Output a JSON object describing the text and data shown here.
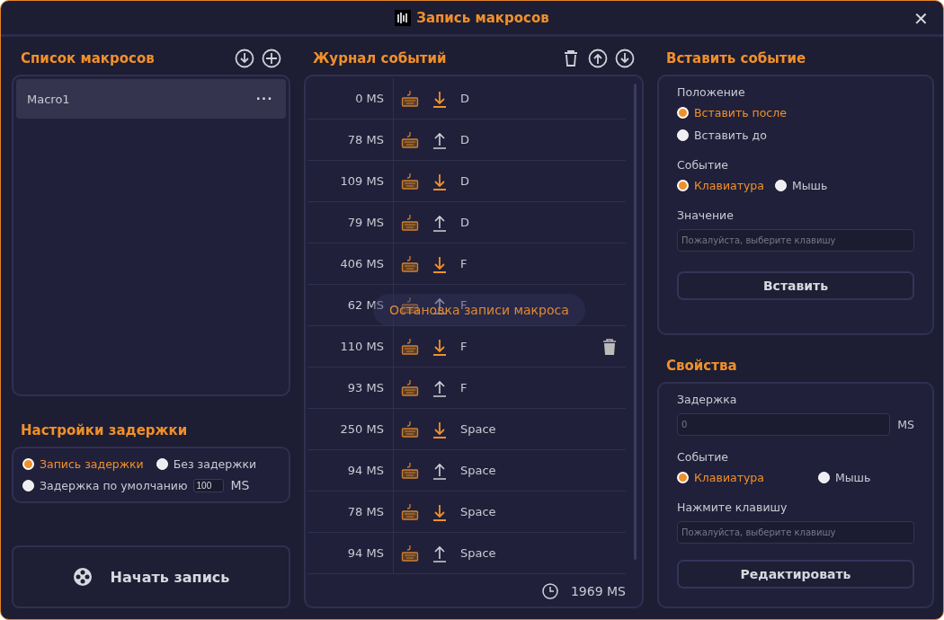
{
  "window": {
    "title": "Запись макросов",
    "close": "✕"
  },
  "macro_list": {
    "title": "Список макросов",
    "items": [
      {
        "name": "Macro1",
        "menu": "···",
        "selected": true
      }
    ]
  },
  "delay_settings": {
    "title": "Настройки задержки",
    "options": [
      {
        "label": "Запись задержки",
        "selected": true
      },
      {
        "label": "Без задержки",
        "selected": false
      },
      {
        "label": "Задержка по умолчанию",
        "selected": false,
        "value": "100",
        "unit": "MS"
      }
    ]
  },
  "start_button": "Начать запись",
  "event_log": {
    "title": "Журнал событий",
    "rows": [
      {
        "delay": "0 MS",
        "kind": "down",
        "key": "D",
        "hovered": false
      },
      {
        "delay": "78 MS",
        "kind": "up",
        "key": "D",
        "hovered": false
      },
      {
        "delay": "109 MS",
        "kind": "down",
        "key": "D",
        "hovered": false
      },
      {
        "delay": "79 MS",
        "kind": "up",
        "key": "D",
        "hovered": false
      },
      {
        "delay": "406 MS",
        "kind": "down",
        "key": "F",
        "hovered": false
      },
      {
        "delay": "62 MS",
        "kind": "up",
        "key": "F",
        "hovered": false
      },
      {
        "delay": "110 MS",
        "kind": "down",
        "key": "F",
        "hovered": true
      },
      {
        "delay": "93 MS",
        "kind": "up",
        "key": "F",
        "hovered": false
      },
      {
        "delay": "250 MS",
        "kind": "down",
        "key": "Space",
        "hovered": false
      },
      {
        "delay": "94 MS",
        "kind": "up",
        "key": "Space",
        "hovered": false
      },
      {
        "delay": "78 MS",
        "kind": "down",
        "key": "Space",
        "hovered": false
      },
      {
        "delay": "94 MS",
        "kind": "up",
        "key": "Space",
        "hovered": false
      }
    ],
    "total": "1969 MS",
    "toast": "Остановка записи макроса"
  },
  "insert_event": {
    "title": "Вставить событие",
    "position_label": "Положение",
    "positions": [
      {
        "label": "Вставить после",
        "selected": true
      },
      {
        "label": "Вставить до",
        "selected": false
      }
    ],
    "event_label": "Событие",
    "events": [
      {
        "label": "Клавиатура",
        "selected": true
      },
      {
        "label": "Мышь",
        "selected": false
      }
    ],
    "value_label": "Значение",
    "value_placeholder": "Пожалуйста, выберите клавишу",
    "button": "Вставить"
  },
  "properties": {
    "title": "Свойства",
    "delay_label": "Задержка",
    "delay_placeholder": "0",
    "delay_unit": "MS",
    "event_label": "Событие",
    "events": [
      {
        "label": "Клавиатура",
        "selected": true
      },
      {
        "label": "Мышь",
        "selected": false
      }
    ],
    "key_label": "Нажмите клавишу",
    "key_placeholder": "Пожалуйста, выберите клавишу",
    "button": "Редактировать"
  }
}
